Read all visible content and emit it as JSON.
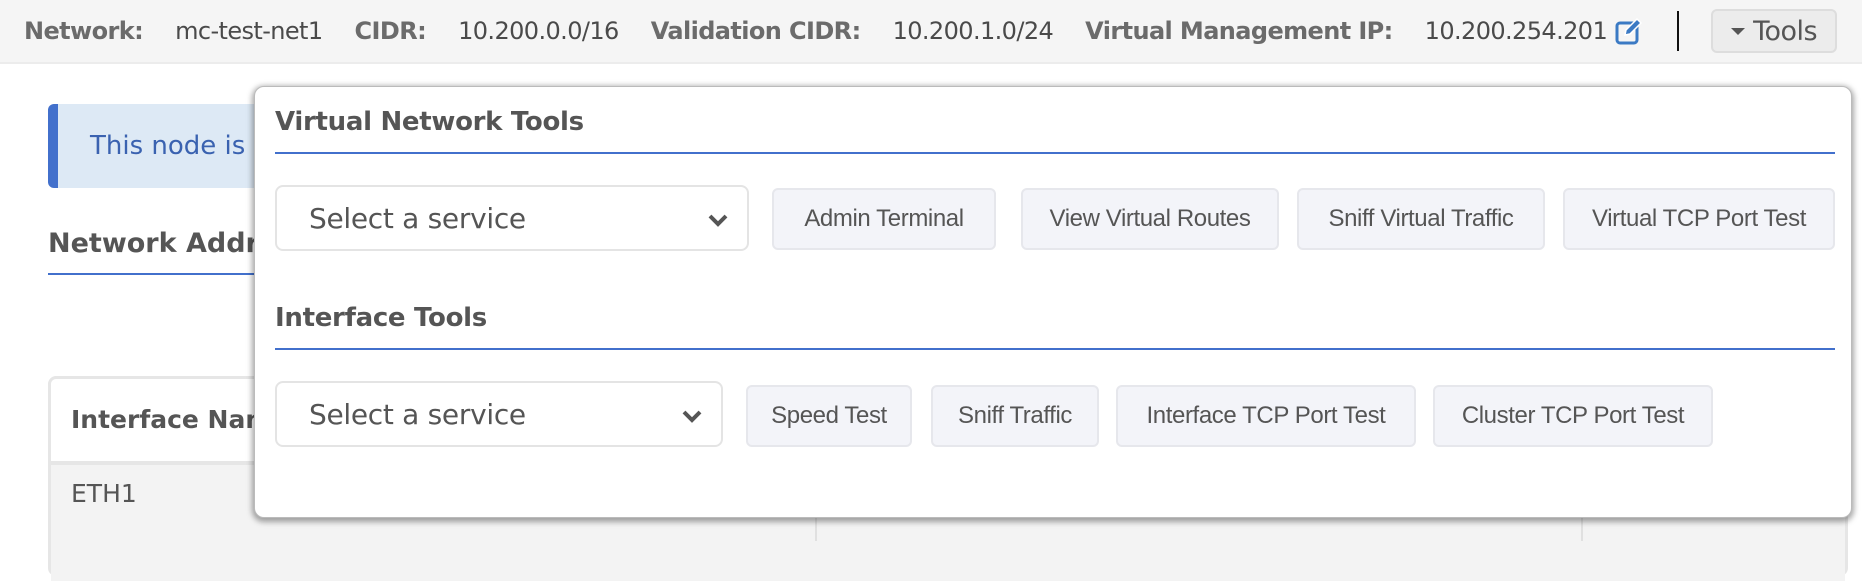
{
  "topbar": {
    "network_label": "Network:",
    "network_value": "mc-test-net1",
    "cidr_label": "CIDR:",
    "cidr_value": "10.200.0.0/16",
    "validation_cidr_label": "Validation CIDR:",
    "validation_cidr_value": "10.200.1.0/24",
    "vmgmt_ip_label": "Virtual Management IP:",
    "vmgmt_ip_value": "10.200.254.201",
    "edit_icon": "edit-icon",
    "tools_label": "Tools"
  },
  "background": {
    "alert_text": "This node is a",
    "section_title": "Network Addre",
    "table": {
      "columns": [
        "Interface Nam"
      ],
      "rows": [
        [
          "ETH1"
        ]
      ]
    }
  },
  "tools_menu": {
    "virtual_network": {
      "title": "Virtual Network Tools",
      "select_value": "Select a service",
      "buttons": [
        "Admin Terminal",
        "View Virtual Routes",
        "Sniff Virtual Traffic",
        "Virtual TCP Port Test"
      ]
    },
    "interface": {
      "title": "Interface Tools",
      "select_value": "Select a service",
      "buttons": [
        "Speed Test",
        "Sniff Traffic",
        "Interface TCP Port Test",
        "Cluster TCP Port Test"
      ]
    }
  },
  "colors": {
    "accent": "#4270cc",
    "edit_icon": "#3b7ac4",
    "alert_bg": "#dde9f5"
  }
}
